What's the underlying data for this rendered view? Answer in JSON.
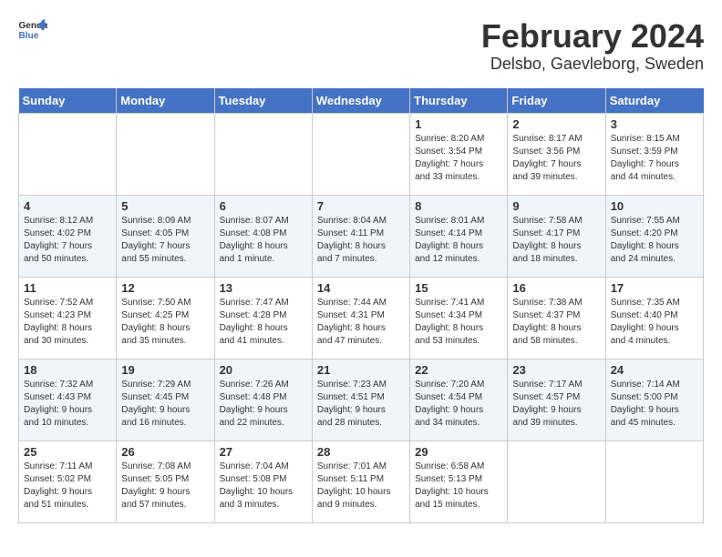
{
  "logo": {
    "text_general": "General",
    "text_blue": "Blue"
  },
  "title": "February 2024",
  "subtitle": "Delsbo, Gaevleborg, Sweden",
  "days_of_week": [
    "Sunday",
    "Monday",
    "Tuesday",
    "Wednesday",
    "Thursday",
    "Friday",
    "Saturday"
  ],
  "weeks": [
    [
      {
        "day": "",
        "info": ""
      },
      {
        "day": "",
        "info": ""
      },
      {
        "day": "",
        "info": ""
      },
      {
        "day": "",
        "info": ""
      },
      {
        "day": "1",
        "info": "Sunrise: 8:20 AM\nSunset: 3:54 PM\nDaylight: 7 hours\nand 33 minutes."
      },
      {
        "day": "2",
        "info": "Sunrise: 8:17 AM\nSunset: 3:56 PM\nDaylight: 7 hours\nand 39 minutes."
      },
      {
        "day": "3",
        "info": "Sunrise: 8:15 AM\nSunset: 3:59 PM\nDaylight: 7 hours\nand 44 minutes."
      }
    ],
    [
      {
        "day": "4",
        "info": "Sunrise: 8:12 AM\nSunset: 4:02 PM\nDaylight: 7 hours\nand 50 minutes."
      },
      {
        "day": "5",
        "info": "Sunrise: 8:09 AM\nSunset: 4:05 PM\nDaylight: 7 hours\nand 55 minutes."
      },
      {
        "day": "6",
        "info": "Sunrise: 8:07 AM\nSunset: 4:08 PM\nDaylight: 8 hours\nand 1 minute."
      },
      {
        "day": "7",
        "info": "Sunrise: 8:04 AM\nSunset: 4:11 PM\nDaylight: 8 hours\nand 7 minutes."
      },
      {
        "day": "8",
        "info": "Sunrise: 8:01 AM\nSunset: 4:14 PM\nDaylight: 8 hours\nand 12 minutes."
      },
      {
        "day": "9",
        "info": "Sunrise: 7:58 AM\nSunset: 4:17 PM\nDaylight: 8 hours\nand 18 minutes."
      },
      {
        "day": "10",
        "info": "Sunrise: 7:55 AM\nSunset: 4:20 PM\nDaylight: 8 hours\nand 24 minutes."
      }
    ],
    [
      {
        "day": "11",
        "info": "Sunrise: 7:52 AM\nSunset: 4:23 PM\nDaylight: 8 hours\nand 30 minutes."
      },
      {
        "day": "12",
        "info": "Sunrise: 7:50 AM\nSunset: 4:25 PM\nDaylight: 8 hours\nand 35 minutes."
      },
      {
        "day": "13",
        "info": "Sunrise: 7:47 AM\nSunset: 4:28 PM\nDaylight: 8 hours\nand 41 minutes."
      },
      {
        "day": "14",
        "info": "Sunrise: 7:44 AM\nSunset: 4:31 PM\nDaylight: 8 hours\nand 47 minutes."
      },
      {
        "day": "15",
        "info": "Sunrise: 7:41 AM\nSunset: 4:34 PM\nDaylight: 8 hours\nand 53 minutes."
      },
      {
        "day": "16",
        "info": "Sunrise: 7:38 AM\nSunset: 4:37 PM\nDaylight: 8 hours\nand 58 minutes."
      },
      {
        "day": "17",
        "info": "Sunrise: 7:35 AM\nSunset: 4:40 PM\nDaylight: 9 hours\nand 4 minutes."
      }
    ],
    [
      {
        "day": "18",
        "info": "Sunrise: 7:32 AM\nSunset: 4:43 PM\nDaylight: 9 hours\nand 10 minutes."
      },
      {
        "day": "19",
        "info": "Sunrise: 7:29 AM\nSunset: 4:45 PM\nDaylight: 9 hours\nand 16 minutes."
      },
      {
        "day": "20",
        "info": "Sunrise: 7:26 AM\nSunset: 4:48 PM\nDaylight: 9 hours\nand 22 minutes."
      },
      {
        "day": "21",
        "info": "Sunrise: 7:23 AM\nSunset: 4:51 PM\nDaylight: 9 hours\nand 28 minutes."
      },
      {
        "day": "22",
        "info": "Sunrise: 7:20 AM\nSunset: 4:54 PM\nDaylight: 9 hours\nand 34 minutes."
      },
      {
        "day": "23",
        "info": "Sunrise: 7:17 AM\nSunset: 4:57 PM\nDaylight: 9 hours\nand 39 minutes."
      },
      {
        "day": "24",
        "info": "Sunrise: 7:14 AM\nSunset: 5:00 PM\nDaylight: 9 hours\nand 45 minutes."
      }
    ],
    [
      {
        "day": "25",
        "info": "Sunrise: 7:11 AM\nSunset: 5:02 PM\nDaylight: 9 hours\nand 51 minutes."
      },
      {
        "day": "26",
        "info": "Sunrise: 7:08 AM\nSunset: 5:05 PM\nDaylight: 9 hours\nand 57 minutes."
      },
      {
        "day": "27",
        "info": "Sunrise: 7:04 AM\nSunset: 5:08 PM\nDaylight: 10 hours\nand 3 minutes."
      },
      {
        "day": "28",
        "info": "Sunrise: 7:01 AM\nSunset: 5:11 PM\nDaylight: 10 hours\nand 9 minutes."
      },
      {
        "day": "29",
        "info": "Sunrise: 6:58 AM\nSunset: 5:13 PM\nDaylight: 10 hours\nand 15 minutes."
      },
      {
        "day": "",
        "info": ""
      },
      {
        "day": "",
        "info": ""
      }
    ]
  ]
}
